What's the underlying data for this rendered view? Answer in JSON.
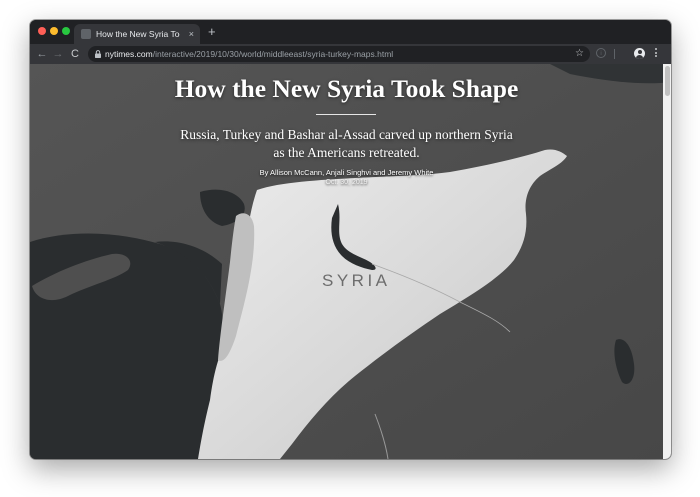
{
  "browser": {
    "tab_title": "How the New Syria Took Shape",
    "tab_close_glyph": "×",
    "new_tab_glyph": "+",
    "url_host": "nytimes.com",
    "url_path": "/interactive/2019/10/30/world/middleeast/syria-turkey-maps.html",
    "back_glyph": "←",
    "forward_glyph": "→",
    "reload_glyph": "C",
    "star_glyph": "☆",
    "info_glyph": "i",
    "icons": [
      "lock-icon",
      "star-icon",
      "account-icon",
      "menu-icon",
      "back-icon",
      "forward-icon",
      "reload-icon",
      "favicon-icon"
    ]
  },
  "article": {
    "headline": "How the New Syria Took Shape",
    "dek": "Russia, Turkey and Bashar al-Assad carved up northern Syria as the Americans retreated.",
    "byline": "By Allison McCann, Anjali Singhvi and Jeremy White",
    "date": "Oct. 30, 2019"
  },
  "map": {
    "country_label": "SYRIA"
  },
  "colors": {
    "chrome_dark": "#202124",
    "chrome_toolbar": "#35363a",
    "map_sea": "#2b2e30",
    "map_land": "#4a4a4a",
    "map_syria": "#d9d9d9"
  }
}
